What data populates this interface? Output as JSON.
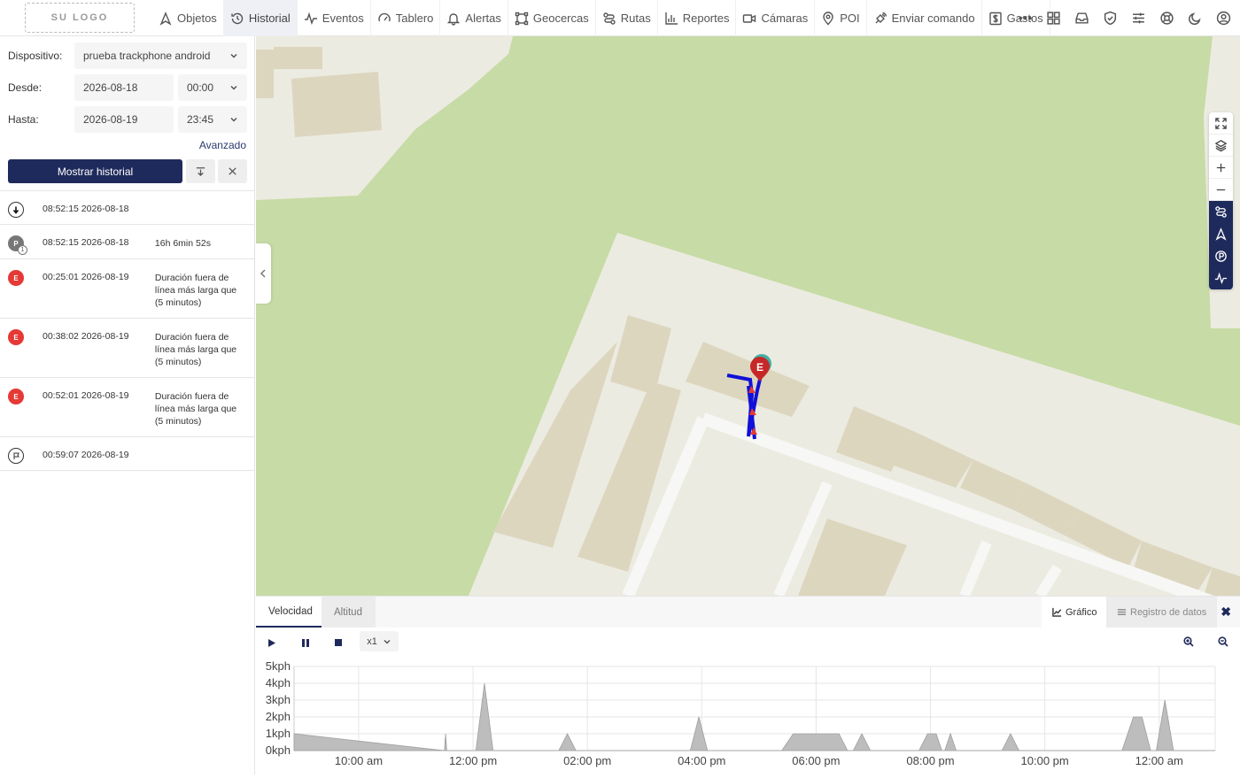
{
  "logo": "SU LOGO",
  "nav": {
    "items": [
      {
        "label": "Objetos",
        "icon": "navigation-arrow-icon",
        "active": false
      },
      {
        "label": "Historial",
        "icon": "history-icon",
        "active": true
      },
      {
        "label": "Eventos",
        "icon": "pulse-icon",
        "active": false
      },
      {
        "label": "Tablero",
        "icon": "gauge-icon",
        "active": false
      },
      {
        "label": "Alertas",
        "icon": "bell-icon",
        "active": false
      },
      {
        "label": "Geocercas",
        "icon": "geofence-icon",
        "active": false
      },
      {
        "label": "Rutas",
        "icon": "route-icon",
        "active": false
      },
      {
        "label": "Reportes",
        "icon": "bar-chart-icon",
        "active": false
      },
      {
        "label": "Cámaras",
        "icon": "video-camera-icon",
        "active": false
      },
      {
        "label": "POI",
        "icon": "map-pin-icon",
        "active": false
      },
      {
        "label": "Enviar comando",
        "icon": "satellite-icon",
        "active": false
      },
      {
        "label": "Gastos",
        "icon": "dollar-icon",
        "active": false
      }
    ],
    "right_icons": [
      "more-icon",
      "grid-icon",
      "inbox-icon",
      "shield-check-icon",
      "sliders-icon",
      "support-icon",
      "moon-icon",
      "user-icon"
    ]
  },
  "form": {
    "device_label": "Dispositivo:",
    "device_value": "prueba trackphone android",
    "from_label": "Desde:",
    "from_date": "2026-08-18",
    "from_time": "00:00",
    "to_label": "Hasta:",
    "to_date": "2026-08-19",
    "to_time": "23:45",
    "advanced": "Avanzado",
    "show_button": "Mostrar historial"
  },
  "history": [
    {
      "type": "start",
      "badge": "",
      "time": "08:52:15 2026-08-18",
      "desc": ""
    },
    {
      "type": "P",
      "badge": "P",
      "sub": "1",
      "time": "08:52:15 2026-08-18",
      "desc": "16h 6min 52s"
    },
    {
      "type": "E",
      "badge": "E",
      "time": "00:25:01 2026-08-19",
      "desc": "Duración fuera de línea más larga que (5 minutos)"
    },
    {
      "type": "E",
      "badge": "E",
      "time": "00:38:02 2026-08-19",
      "desc": "Duración fuera de línea más larga que (5 minutos)"
    },
    {
      "type": "E",
      "badge": "E",
      "time": "00:52:01 2026-08-19",
      "desc": "Duración fuera de línea más larga que (5 minutos)"
    },
    {
      "type": "end",
      "badge": "",
      "time": "00:59:07 2026-08-19",
      "desc": ""
    }
  ],
  "map": {
    "marker_label": "E",
    "colors": {
      "grass": "#c7dba6",
      "land": "#ecebe1",
      "building": "#ddd6bf",
      "road": "#f7f7f5",
      "route": "#1010d8",
      "marker": "#c62828"
    },
    "tools": [
      "fullscreen-icon",
      "layers-icon",
      "zoom-in-icon",
      "zoom-out-icon",
      "route-toggle-icon",
      "direction-icon",
      "parking-icon",
      "pulse-icon"
    ]
  },
  "bottom": {
    "tabs": [
      "Velocidad",
      "Altitud"
    ],
    "view_tabs": [
      "Gráfico",
      "Registro de datos"
    ],
    "playback_speed": "x1"
  },
  "chart_data": {
    "type": "area",
    "title": "",
    "xlabel": "",
    "ylabel": "",
    "y_unit": "kph",
    "ylim": [
      0,
      5
    ],
    "y_ticks": [
      "5kph",
      "4kph",
      "3kph",
      "2kph",
      "1kph",
      "0kph"
    ],
    "x_ticks": [
      "10:00 am",
      "12:00 pm",
      "02:00 pm",
      "04:00 pm",
      "06:00 pm",
      "08:00 pm",
      "10:00 pm",
      "12:00 am"
    ],
    "x_hour_range": [
      8.87,
      24.98
    ],
    "x_tick_hours": [
      10,
      12,
      14,
      16,
      18,
      20,
      22,
      24
    ],
    "series": [
      {
        "color": "#bdbdbd",
        "points": [
          [
            8.87,
            1.0
          ],
          [
            11.5,
            0.0
          ],
          [
            11.52,
            1.0
          ],
          [
            11.54,
            0.0
          ],
          [
            12.05,
            0.0
          ],
          [
            12.2,
            4.0
          ],
          [
            12.35,
            0.0
          ],
          [
            13.5,
            0.0
          ],
          [
            13.65,
            1.0
          ],
          [
            13.8,
            0.0
          ],
          [
            15.8,
            0.0
          ],
          [
            15.95,
            2.0
          ],
          [
            16.1,
            0.0
          ],
          [
            17.4,
            0.0
          ],
          [
            17.6,
            1.0
          ],
          [
            18.4,
            1.0
          ],
          [
            18.55,
            0.0
          ],
          [
            18.65,
            0.0
          ],
          [
            18.8,
            1.0
          ],
          [
            18.95,
            0.0
          ],
          [
            19.8,
            0.0
          ],
          [
            19.95,
            1.0
          ],
          [
            20.1,
            1.0
          ],
          [
            20.2,
            0.0
          ],
          [
            20.25,
            0.0
          ],
          [
            20.35,
            1.0
          ],
          [
            20.45,
            0.0
          ],
          [
            21.25,
            0.0
          ],
          [
            21.4,
            1.0
          ],
          [
            21.55,
            0.0
          ],
          [
            23.35,
            0.0
          ],
          [
            23.55,
            2.0
          ],
          [
            23.7,
            2.0
          ],
          [
            23.85,
            0.0
          ],
          [
            23.95,
            0.0
          ],
          [
            24.1,
            3.0
          ],
          [
            24.25,
            0.0
          ],
          [
            24.98,
            0.0
          ]
        ]
      }
    ],
    "grid": true
  }
}
